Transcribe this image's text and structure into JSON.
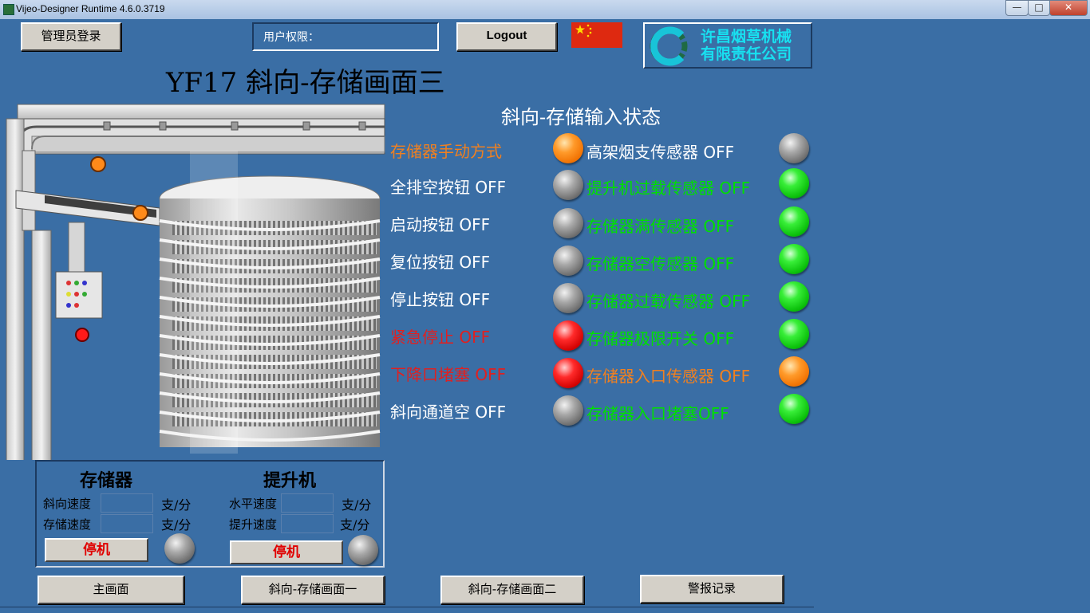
{
  "window": {
    "title": "Vijeo-Designer Runtime 4.6.0.3719",
    "min": "—",
    "max": "□",
    "close": "✕"
  },
  "header": {
    "admin_login": "管理员登录",
    "user_rights_label": "用户权限：",
    "logout": "Logout",
    "company_line1": "许昌烟草机械",
    "company_line2": "有限责任公司",
    "page_title": "YF17  斜向-存储画面三",
    "section_title": "斜向-存储输入状态"
  },
  "colors": {
    "background": "#3a6ea5",
    "white_text": "#ffffff",
    "green_text": "#00e000",
    "orange_text": "#f08020",
    "red_text": "#e02020"
  },
  "left_inputs": [
    {
      "label": "存储器手动方式",
      "color": "orange",
      "lamp": "orange"
    },
    {
      "label": "全排空按钮  OFF",
      "color": "white",
      "lamp": "gray"
    },
    {
      "label": "启动按钮  OFF",
      "color": "white",
      "lamp": "gray"
    },
    {
      "label": "复位按钮  OFF",
      "color": "white",
      "lamp": "gray"
    },
    {
      "label": "停止按钮  OFF",
      "color": "white",
      "lamp": "gray"
    },
    {
      "label": "紧急停止  OFF",
      "color": "red",
      "lamp": "red"
    },
    {
      "label": "下降口堵塞  OFF",
      "color": "red",
      "lamp": "red"
    },
    {
      "label": "斜向通道空  OFF",
      "color": "white",
      "lamp": "gray"
    }
  ],
  "right_inputs": [
    {
      "label": "高架烟支传感器  OFF",
      "color": "white",
      "lamp": "gray"
    },
    {
      "label": "提升机过载传感器  OFF",
      "color": "green",
      "lamp": "green"
    },
    {
      "label": "存储器满传感器  OFF",
      "color": "green",
      "lamp": "green"
    },
    {
      "label": "存储器空传感器  OFF",
      "color": "green",
      "lamp": "green"
    },
    {
      "label": "存储器过载传感器  OFF",
      "color": "green",
      "lamp": "green"
    },
    {
      "label": "存储器极限开关  OFF",
      "color": "green",
      "lamp": "green"
    },
    {
      "label": "存储器入口传感器  OFF",
      "color": "orange",
      "lamp": "orange"
    },
    {
      "label": "存储器入口堵塞OFF",
      "color": "green",
      "lamp": "green"
    }
  ],
  "status_panel": {
    "storage": {
      "title": "存储器",
      "row1": "斜向速度",
      "row2": "存储速度",
      "unit": "支/分",
      "stop": "停机"
    },
    "lift": {
      "title": "提升机",
      "row1": "水平速度",
      "row2": "提升速度",
      "unit": "支/分",
      "stop": "停机"
    }
  },
  "nav": {
    "main": "主画面",
    "screen1": "斜向-存储画面一",
    "screen2": "斜向-存储画面二",
    "alarm": "警报记录"
  }
}
